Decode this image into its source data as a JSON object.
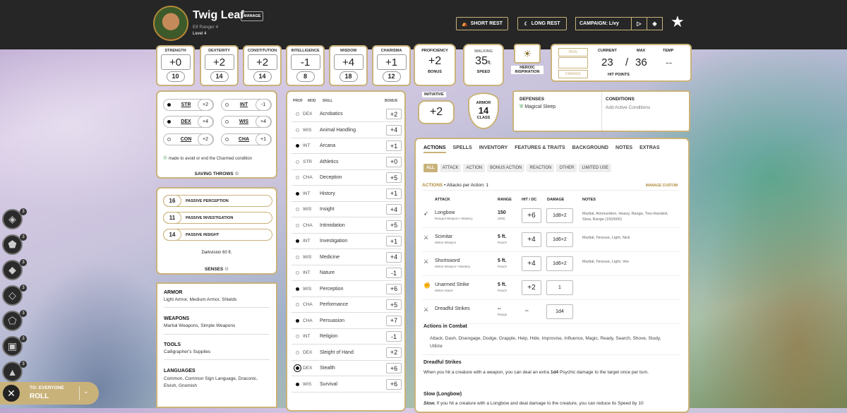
{
  "header": {
    "name": "Twig Leaf",
    "manage": "MANAGE",
    "subtitle": "Elf Ranger 4",
    "level": "Level 4",
    "short_rest": "SHORT REST",
    "long_rest": "LONG REST",
    "campaign": "CAMPAIGN: Livy"
  },
  "abilities": [
    {
      "name": "STRENGTH",
      "mod": "+0",
      "score": "10"
    },
    {
      "name": "DEXTERITY",
      "mod": "+2",
      "score": "14"
    },
    {
      "name": "CONSTITUTION",
      "mod": "+2",
      "score": "14"
    },
    {
      "name": "INTELLIGENCE",
      "mod": "-1",
      "score": "8"
    },
    {
      "name": "WISDOM",
      "mod": "+4",
      "score": "18"
    },
    {
      "name": "CHARISMA",
      "mod": "+1",
      "score": "12"
    }
  ],
  "proficiency": {
    "label": "PROFICIENCY",
    "value": "+2",
    "sub": "BONUS"
  },
  "speed": {
    "label": "WALKING",
    "value": "35",
    "unit": "ft.",
    "sub": "SPEED"
  },
  "heroic": {
    "label1": "HEROIC",
    "label2": "INSPIRATION"
  },
  "hp": {
    "heal": "HEAL",
    "damage": "DAMAGE",
    "current_label": "CURRENT",
    "max_label": "MAX",
    "temp_label": "TEMP",
    "current": "23",
    "slash": "/",
    "max": "36",
    "temp": "--",
    "title": "HIT POINTS"
  },
  "initiative": {
    "label": "INITIATIVE",
    "value": "+2"
  },
  "armor": {
    "label": "ARMOR",
    "value": "14",
    "sub": "CLASS"
  },
  "defenses": {
    "title": "DEFENSES",
    "item": "Magical Sleep"
  },
  "conditions": {
    "title": "CONDITIONS",
    "add": "Add Active Conditions"
  },
  "saves": [
    {
      "name": "STR",
      "bonus": "+2",
      "prof": true
    },
    {
      "name": "INT",
      "bonus": "-1",
      "prof": false
    },
    {
      "name": "DEX",
      "bonus": "+4",
      "prof": true
    },
    {
      "name": "WIS",
      "bonus": "+4",
      "prof": false
    },
    {
      "name": "CON",
      "bonus": "+2",
      "prof": false
    },
    {
      "name": "CHA",
      "bonus": "+1",
      "prof": false
    }
  ],
  "save_note": "made to avoid or end the Charmed condition",
  "saving_throws_title": "SAVING THROWS",
  "passives": [
    {
      "value": "16",
      "label": "PASSIVE PERCEPTION"
    },
    {
      "value": "11",
      "label": "PASSIVE INVESTIGATION"
    },
    {
      "value": "14",
      "label": "PASSIVE INSIGHT"
    }
  ],
  "darkvision": "Darkvision 60 ft.",
  "senses_title": "SENSES",
  "profs": {
    "armor_title": "ARMOR",
    "armor": "Light Armor, Medium Armor, Shields",
    "weapons_title": "WEAPONS",
    "weapons": "Martial Weapons, Simple Weapons",
    "tools_title": "TOOLS",
    "tools": "Calligrapher's Supplies",
    "lang_title": "LANGUAGES",
    "lang": "Common, Common Sign Language, Draconic, Elvish, Gnomish"
  },
  "skills_header": {
    "prof": "PROF",
    "mod": "MOD",
    "skill": "SKILL",
    "bonus": "BONUS"
  },
  "skills": [
    {
      "mod": "DEX",
      "name": "Acrobatics",
      "bonus": "+2",
      "prof": "none"
    },
    {
      "mod": "WIS",
      "name": "Animal Handling",
      "bonus": "+4",
      "prof": "none"
    },
    {
      "mod": "INT",
      "name": "Arcana",
      "bonus": "+1",
      "prof": "prof"
    },
    {
      "mod": "STR",
      "name": "Athletics",
      "bonus": "+0",
      "prof": "none"
    },
    {
      "mod": "CHA",
      "name": "Deception",
      "bonus": "+5",
      "prof": "none"
    },
    {
      "mod": "INT",
      "name": "History",
      "bonus": "+1",
      "prof": "prof"
    },
    {
      "mod": "WIS",
      "name": "Insight",
      "bonus": "+4",
      "prof": "none"
    },
    {
      "mod": "CHA",
      "name": "Intimidation",
      "bonus": "+5",
      "prof": "none"
    },
    {
      "mod": "INT",
      "name": "Investigation",
      "bonus": "+1",
      "prof": "prof"
    },
    {
      "mod": "WIS",
      "name": "Medicine",
      "bonus": "+4",
      "prof": "none"
    },
    {
      "mod": "INT",
      "name": "Nature",
      "bonus": "-1",
      "prof": "none"
    },
    {
      "mod": "WIS",
      "name": "Perception",
      "bonus": "+6",
      "prof": "prof"
    },
    {
      "mod": "CHA",
      "name": "Performance",
      "bonus": "+5",
      "prof": "none"
    },
    {
      "mod": "CHA",
      "name": "Persuasion",
      "bonus": "+7",
      "prof": "prof"
    },
    {
      "mod": "INT",
      "name": "Religion",
      "bonus": "-1",
      "prof": "none"
    },
    {
      "mod": "DEX",
      "name": "Sleight of Hand",
      "bonus": "+2",
      "prof": "none"
    },
    {
      "mod": "DEX",
      "name": "Stealth",
      "bonus": "+6",
      "prof": "expert"
    },
    {
      "mod": "WIS",
      "name": "Survival",
      "bonus": "+6",
      "prof": "prof"
    }
  ],
  "tabs": [
    "ACTIONS",
    "SPELLS",
    "INVENTORY",
    "FEATURES & TRAITS",
    "BACKGROUND",
    "NOTES",
    "EXTRAS"
  ],
  "filters": [
    "ALL",
    "ATTACK",
    "ACTION",
    "BONUS ACTION",
    "REACTION",
    "OTHER",
    "LIMITED USE"
  ],
  "actions_title": "ACTIONS",
  "attacks_per": "• Attacks per Action: 1",
  "manage_custom": "MANAGE CUSTOM",
  "atk_headers": {
    "attack": "ATTACK",
    "range": "RANGE",
    "hit": "HIT / DC",
    "damage": "DAMAGE",
    "notes": "NOTES"
  },
  "attacks": [
    {
      "name": "Longbow",
      "sub": "Ranged Weapon • Mastery",
      "range": "150",
      "range_sub": "(600)",
      "hit": "+6",
      "damage": "1d8+2",
      "notes": "Martial, Ammunition, Heavy, Range, Two-Handed, Slow, Range (150/600)"
    },
    {
      "name": "Scimitar",
      "sub": "Melee Weapon",
      "range": "5 ft.",
      "range_sub": "Reach",
      "hit": "+4",
      "damage": "1d6+2",
      "notes": "Martial, Finesse, Light, Nick"
    },
    {
      "name": "Shortsword",
      "sub": "Melee Weapon • Mastery",
      "range": "5 ft.",
      "range_sub": "Reach",
      "hit": "+4",
      "damage": "1d6+2",
      "notes": "Martial, Finesse, Light, Vex"
    },
    {
      "name": "Unarmed Strike",
      "sub": "Melee Attack",
      "range": "5 ft.",
      "range_sub": "Reach",
      "hit": "+2",
      "damage": "1",
      "notes": ""
    },
    {
      "name": "Dreadful Strikes",
      "sub": "",
      "range": "--",
      "range_sub": "Range",
      "hit": "--",
      "damage": "1d4",
      "notes": ""
    }
  ],
  "combat_title": "Actions in Combat",
  "combat_text": "Attack, Dash, Disengage, Dodge, Grapple, Help, Hide, Improvise, Influence, Magic, Ready, Search, Shove, Study, Utilize",
  "dreadful_title": "Dreadful Strikes",
  "dreadful_pre": "When you hit a creature with a weapon, you can deal an extra",
  "dreadful_bold": "1d4",
  "dreadful_post": "Psychic damage to the target once per turn.",
  "slow_title": "Slow (Longbow)",
  "slow_lead": "Slow.",
  "slow_text": "If you hit a creature with a Longbow and deal damage to the creature, you can reduce its Speed by 10",
  "roll": {
    "to": "TO: EVERYONE",
    "label": "ROLL"
  },
  "side_counts": [
    "3",
    "3",
    "3",
    "3",
    "3",
    "3",
    "3"
  ]
}
